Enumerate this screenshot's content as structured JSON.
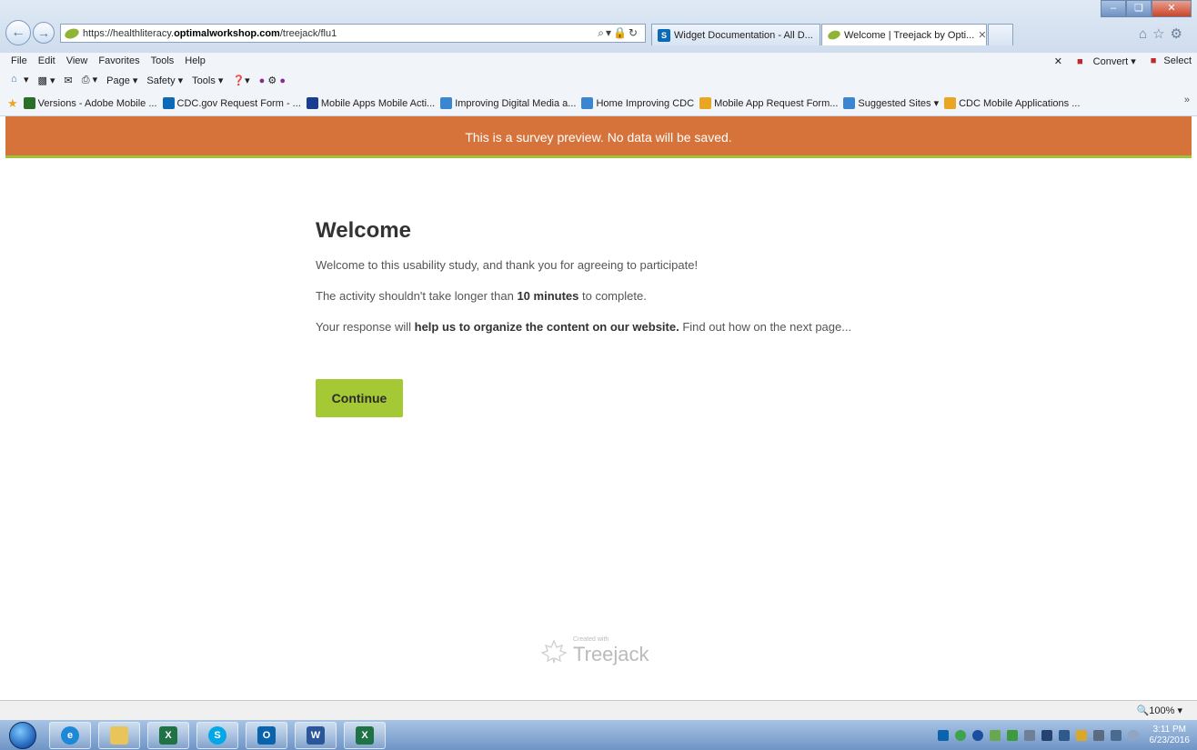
{
  "browser": {
    "url_prefix": "https://healthliteracy.",
    "url_domain": "optimalworkshop.com",
    "url_path": "/treejack/flu1",
    "tabs": [
      {
        "title": "Widget Documentation - All D..."
      },
      {
        "title": "Welcome | Treejack by Opti..."
      }
    ],
    "menu": [
      "File",
      "Edit",
      "View",
      "Favorites",
      "Tools",
      "Help"
    ],
    "menu_right": {
      "convert": "Convert",
      "select": "Select"
    },
    "commands": {
      "page": "Page",
      "safety": "Safety",
      "tools": "Tools"
    },
    "favorites": [
      {
        "label": "Versions - Adobe Mobile ...",
        "color": "#2a6e2a"
      },
      {
        "label": "CDC.gov Request Form - ...",
        "color": "#0b6ab7"
      },
      {
        "label": "Mobile Apps Mobile Acti...",
        "color": "#1a3d8f"
      },
      {
        "label": "Improving Digital Media a...",
        "color": "#3a86d0"
      },
      {
        "label": "Home Improving CDC",
        "color": "#3a86d0"
      },
      {
        "label": "Mobile App Request Form...",
        "color": "#e8a623"
      },
      {
        "label": "Suggested Sites",
        "color": "#3a86d0"
      },
      {
        "label": "CDC Mobile Applications ...",
        "color": "#e8a623"
      }
    ],
    "zoom": "100%"
  },
  "page": {
    "banner": "This is a survey preview. No data will be saved.",
    "title": "Welcome",
    "p1": "Welcome to this usability study, and thank you for agreeing to participate!",
    "p2_a": "The activity shouldn't take longer than ",
    "p2_b": "10 minutes",
    "p2_c": " to complete.",
    "p3_a": "Your response will ",
    "p3_b": "help us to organize the content on our website.",
    "p3_c": " Find out how on the next page...",
    "continue_label": "Continue",
    "footer_created": "Created with",
    "footer_name": "Treejack"
  },
  "taskbar": {
    "apps": [
      {
        "name": "ie",
        "glyph": "e",
        "color": "#1e88d8"
      },
      {
        "name": "explorer",
        "glyph": "",
        "color": "#e9c45a"
      },
      {
        "name": "excel",
        "glyph": "X",
        "color": "#1f7244"
      },
      {
        "name": "skype",
        "glyph": "S",
        "color": "#00a8e8"
      },
      {
        "name": "outlook",
        "glyph": "O",
        "color": "#0a64ad"
      },
      {
        "name": "word",
        "glyph": "W",
        "color": "#2b579a"
      },
      {
        "name": "excel",
        "glyph": "X",
        "color": "#1f7244"
      }
    ],
    "time": "3:11 PM",
    "date": "6/23/2016"
  },
  "colors": {
    "banner": "#d5733a",
    "accent": "#a5c935"
  }
}
